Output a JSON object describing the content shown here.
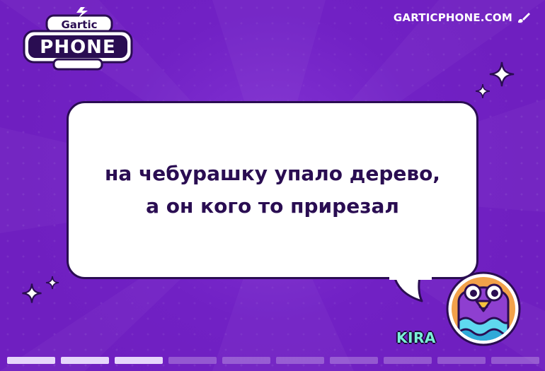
{
  "app": {
    "logo_top": "Gartic",
    "logo_bottom": "PHONE",
    "site": "GARTICPHONE.COM",
    "site_icon": "brush-icon"
  },
  "bubble": {
    "text": "на чебурашку упало дерево,\nа он кого то прирезал"
  },
  "player": {
    "name": "KIRA",
    "avatar": "purple-bird-avatar"
  },
  "colors": {
    "background": "#6f1fc0",
    "bubble_border": "#2a0d52",
    "text": "#2a0d52",
    "name": "#7af0d6"
  },
  "progress": {
    "total": 10,
    "completed": 3
  }
}
